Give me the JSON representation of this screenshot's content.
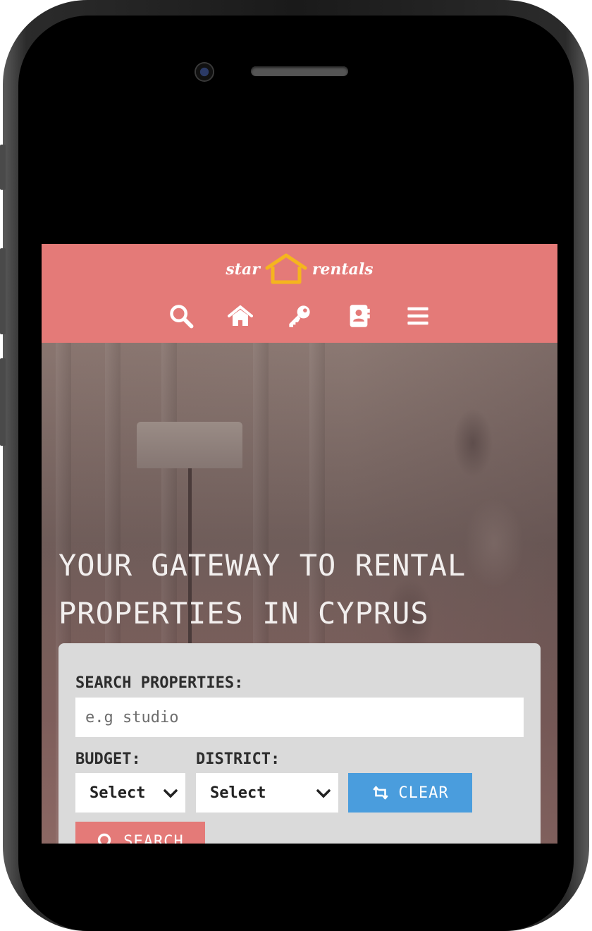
{
  "header": {
    "logo_left": "star",
    "logo_right": "rentals",
    "brand_color": "#e47a78",
    "nav": [
      {
        "icon": "search-icon",
        "label": ""
      },
      {
        "icon": "home-icon",
        "label": ""
      },
      {
        "icon": "key-icon",
        "label": ""
      },
      {
        "icon": "contacts-icon",
        "label": ""
      },
      {
        "icon": "menu-icon",
        "label": ""
      }
    ]
  },
  "hero": {
    "headline": "YOUR GATEWAY TO RENTAL PROPERTIES IN CYPRUS"
  },
  "search": {
    "title": "SEARCH PROPERTIES:",
    "placeholder": "e.g studio",
    "budget_label": "BUDGET:",
    "budget_value": "Select",
    "district_label": "DISTRICT:",
    "district_value": "Select",
    "clear_label": "CLEAR",
    "search_label": "SEARCH",
    "clear_color": "#4a9ddd",
    "search_color": "#e47a78"
  }
}
